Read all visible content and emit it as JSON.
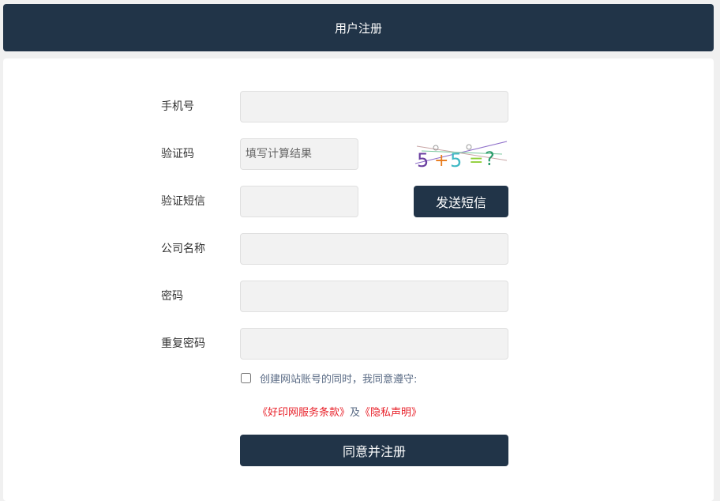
{
  "header": {
    "title": "用户注册"
  },
  "form": {
    "phone_label": "手机号",
    "captcha_label": "验证码",
    "captcha_placeholder": "填写计算结果",
    "captcha_image": {
      "text": "5 + 5 = ?"
    },
    "sms_label": "验证短信",
    "sms_button": "发送短信",
    "company_label": "公司名称",
    "password_label": "密码",
    "password_confirm_label": "重复密码",
    "agree_text": "创建网站账号的同时，我同意遵守:",
    "terms_link": "《好印网服务条款》",
    "terms_and": "及",
    "privacy_link": "《隐私声明》",
    "submit_button": "同意并注册"
  },
  "colors": {
    "primary": "#213448",
    "link_red": "#e8212a",
    "field_bg": "#f2f2f2"
  }
}
